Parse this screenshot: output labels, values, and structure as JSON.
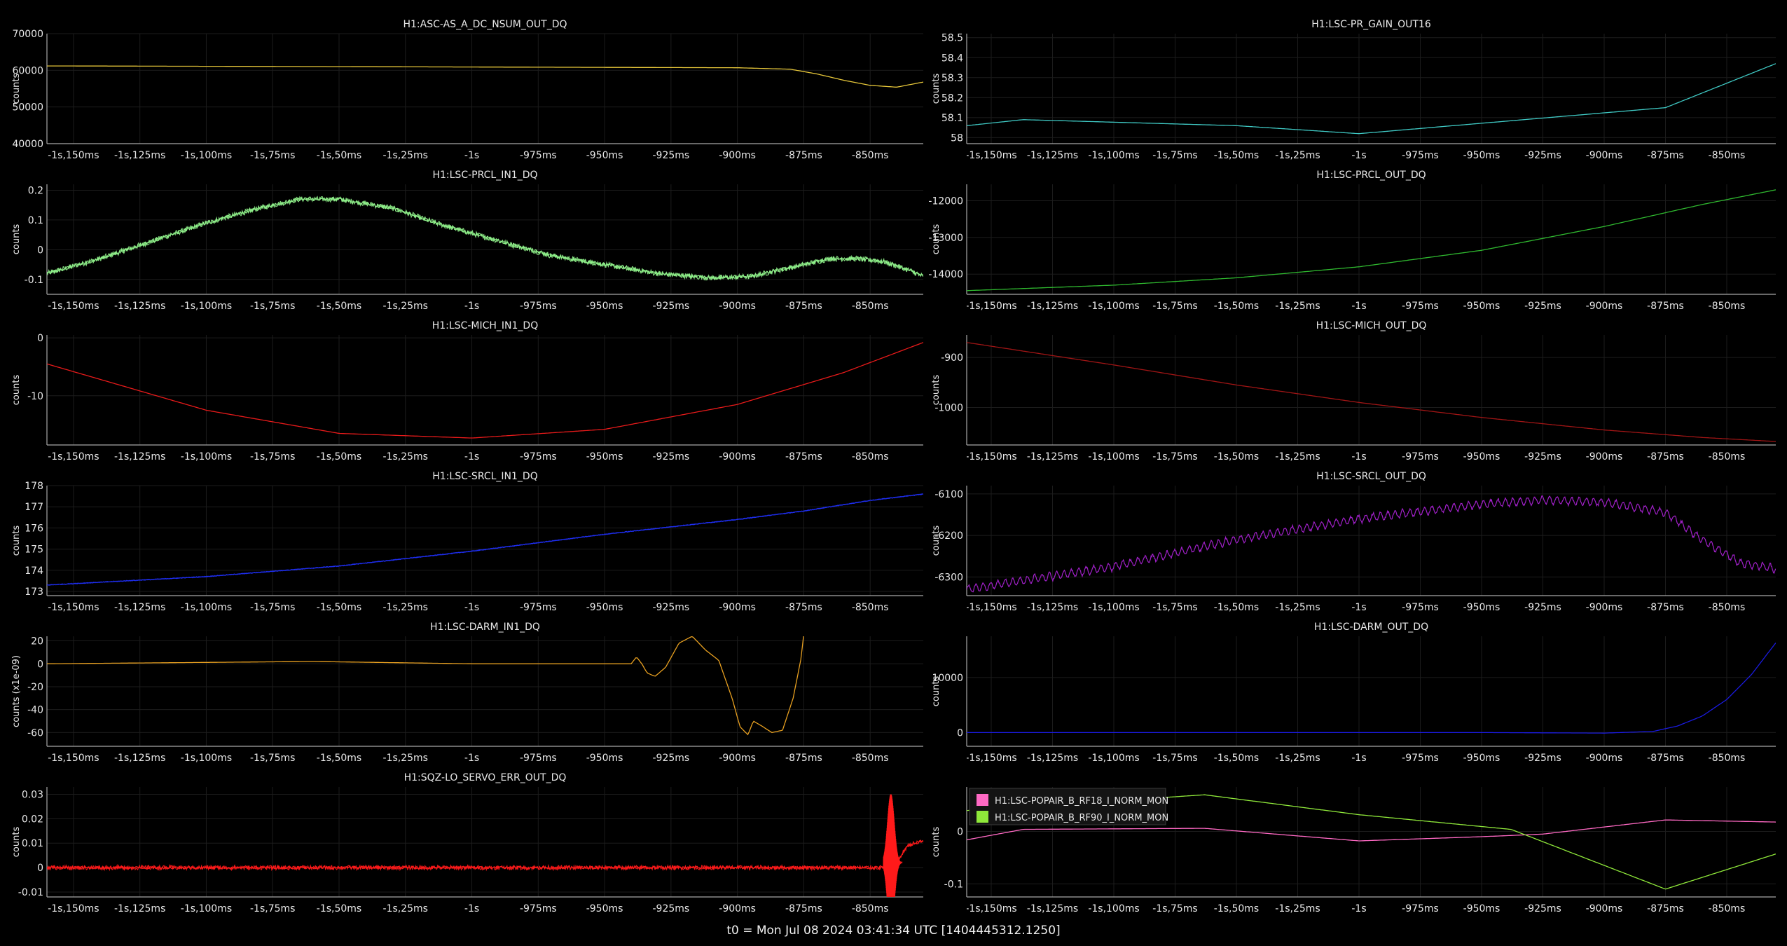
{
  "footer": "t0 = Mon Jul 08 2024 03:41:34 UTC [1404445312.1250]",
  "x_axis": {
    "xlim": [
      -1160,
      -830
    ],
    "ticks": [
      -1150,
      -1125,
      -1100,
      -1075,
      -1050,
      -1025,
      -1000,
      -975,
      -950,
      -925,
      -900,
      -875,
      -850
    ],
    "labels": [
      "-1s,150ms",
      "-1s,125ms",
      "-1s,100ms",
      "-1s,75ms",
      "-1s,50ms",
      "-1s,25ms",
      "-1s",
      "-975ms",
      "-950ms",
      "-925ms",
      "-900ms",
      "-875ms",
      "-850ms"
    ]
  },
  "chart_data": [
    {
      "type": "line",
      "title": "H1:ASC-AS_A_DC_NSUM_OUT_DQ",
      "ylabel": "counts",
      "ylim": [
        40000,
        70000
      ],
      "yticks": [
        40000,
        50000,
        60000,
        70000
      ],
      "ytick_labels": [
        "40000",
        "50000",
        "60000",
        "70000"
      ],
      "color": "#e8c83a",
      "noise": 0,
      "cycles": 0,
      "series": [
        {
          "x": [
            -1160,
            -1100,
            -1050,
            -1000,
            -950,
            -900,
            -880,
            -870,
            -860,
            -850,
            -840,
            -830
          ],
          "y": [
            61200,
            61100,
            61000,
            60900,
            60800,
            60700,
            60300,
            59000,
            57300,
            55900,
            55400,
            56800
          ]
        }
      ]
    },
    {
      "type": "line",
      "title": "H1:LSC-PR_GAIN_OUT16",
      "ylabel": "counts",
      "ylim": [
        57.97,
        58.52
      ],
      "yticks": [
        58,
        58.1,
        58.2,
        58.3,
        58.4,
        58.5
      ],
      "ytick_labels": [
        "58",
        "58.1",
        "58.2",
        "58.3",
        "58.4",
        "58.5"
      ],
      "color": "#3fc9c4",
      "noise": 0,
      "cycles": 0,
      "series": [
        {
          "x": [
            -1160,
            -1137,
            -1050,
            -1000,
            -875,
            -830
          ],
          "y": [
            58.06,
            58.09,
            58.06,
            58.02,
            58.15,
            58.37
          ]
        }
      ]
    },
    {
      "type": "line",
      "title": "H1:LSC-PRCL_IN1_DQ",
      "ylabel": "counts",
      "ylim": [
        -0.15,
        0.22
      ],
      "yticks": [
        -0.1,
        0,
        0.1,
        0.2
      ],
      "ytick_labels": [
        "-0.1",
        "0",
        "0.1",
        "0.2"
      ],
      "color": "#8ff08a",
      "noise": 0.009,
      "cycles": 0,
      "band": 0.015,
      "series": [
        {
          "x": [
            -1160,
            -1140,
            -1120,
            -1100,
            -1080,
            -1065,
            -1050,
            -1030,
            -1010,
            -990,
            -970,
            -950,
            -930,
            -910,
            -895,
            -880,
            -865,
            -855,
            -845,
            -835,
            -830
          ],
          "y": [
            -0.08,
            -0.03,
            0.03,
            0.09,
            0.14,
            0.17,
            0.17,
            0.14,
            0.08,
            0.03,
            -0.02,
            -0.05,
            -0.08,
            -0.095,
            -0.09,
            -0.06,
            -0.03,
            -0.03,
            -0.04,
            -0.07,
            -0.09
          ]
        }
      ]
    },
    {
      "type": "line",
      "title": "H1:LSC-PRCL_OUT_DQ",
      "ylabel": "counts",
      "ylim": [
        -14550,
        -11550
      ],
      "yticks": [
        -14000,
        -13000,
        -12000
      ],
      "ytick_labels": [
        "-14000",
        "-13000",
        "-12000"
      ],
      "color": "#2fb82f",
      "noise": 0,
      "cycles": 0,
      "series": [
        {
          "x": [
            -1160,
            -1100,
            -1050,
            -1000,
            -950,
            -900,
            -860,
            -830
          ],
          "y": [
            -14450,
            -14300,
            -14100,
            -13800,
            -13350,
            -12700,
            -12100,
            -11700
          ]
        }
      ]
    },
    {
      "type": "line",
      "title": "H1:LSC-MICH_IN1_DQ",
      "ylabel": "counts",
      "ylim": [
        -18.5,
        0.5
      ],
      "yticks": [
        -10,
        0
      ],
      "ytick_labels": [
        "-10",
        "0"
      ],
      "color": "#e81a1a",
      "noise": 0,
      "cycles": 0,
      "series": [
        {
          "x": [
            -1160,
            -1100,
            -1050,
            -1000,
            -950,
            -900,
            -860,
            -830
          ],
          "y": [
            -4.5,
            -12.5,
            -16.5,
            -17.3,
            -15.8,
            -11.5,
            -6,
            -0.8
          ]
        }
      ]
    },
    {
      "type": "line",
      "title": "H1:LSC-MICH_OUT_DQ",
      "ylabel": "counts",
      "ylim": [
        -1075,
        -855
      ],
      "yticks": [
        -1000,
        -900
      ],
      "ytick_labels": [
        "-1000",
        "-900"
      ],
      "color": "#a01515",
      "noise": 0,
      "cycles": 0,
      "series": [
        {
          "x": [
            -1160,
            -1100,
            -1050,
            -1000,
            -950,
            -900,
            -860,
            -830
          ],
          "y": [
            -870,
            -915,
            -955,
            -990,
            -1020,
            -1045,
            -1060,
            -1068
          ]
        }
      ]
    },
    {
      "type": "line",
      "title": "H1:LSC-SRCL_IN1_DQ",
      "ylabel": "counts",
      "ylim": [
        172.8,
        178.0
      ],
      "yticks": [
        173,
        174,
        175,
        176,
        177,
        178
      ],
      "ytick_labels": [
        "173",
        "174",
        "175",
        "176",
        "177",
        "178"
      ],
      "color": "#1e2ef0",
      "noise": 0.02,
      "cycles": 0,
      "band": 0.03,
      "series": [
        {
          "x": [
            -1160,
            -1100,
            -1050,
            -1000,
            -950,
            -900,
            -875,
            -850,
            -830
          ],
          "y": [
            173.3,
            173.7,
            174.2,
            174.9,
            175.7,
            176.4,
            176.8,
            177.3,
            177.6
          ]
        }
      ]
    },
    {
      "type": "line",
      "title": "H1:LSC-SRCL_OUT_DQ",
      "ylabel": "counts",
      "ylim": [
        -6345,
        -6080
      ],
      "yticks": [
        -6300,
        -6200,
        -6100
      ],
      "ytick_labels": [
        "-6300",
        "-6200",
        "-6100"
      ],
      "color": "#a020c8",
      "noise": 3,
      "cycles": 110,
      "cycamp": 11,
      "series": [
        {
          "x": [
            -1160,
            -1100,
            -1050,
            -1000,
            -950,
            -925,
            -900,
            -875,
            -860,
            -845,
            -830
          ],
          "y": [
            -6330,
            -6275,
            -6210,
            -6160,
            -6125,
            -6115,
            -6120,
            -6145,
            -6210,
            -6265,
            -6280
          ]
        }
      ]
    },
    {
      "type": "line",
      "title": "H1:LSC-DARM_IN1_DQ",
      "ylabel": "counts (x1e-09)",
      "ylim": [
        -72,
        24
      ],
      "yticks": [
        -60,
        -40,
        -20,
        0,
        20
      ],
      "ytick_labels": [
        "-60",
        "-40",
        "-20",
        "0",
        "20"
      ],
      "color": "#e8a020",
      "noise": 0,
      "cycles": 0,
      "series": [
        {
          "x": [
            -1160,
            -1060,
            -1000,
            -945,
            -940,
            -938,
            -936,
            -934,
            -931,
            -927,
            -922,
            -917,
            -912,
            -907,
            -902,
            -899,
            -896,
            -894,
            -891,
            -887,
            -883,
            -879,
            -876,
            -875
          ],
          "y": [
            0,
            2,
            0,
            0,
            0,
            6,
            0,
            -8,
            -11,
            -3,
            18,
            24,
            12,
            3,
            -30,
            -55,
            -62,
            -50,
            -54,
            -60,
            -58,
            -30,
            5,
            26
          ]
        }
      ]
    },
    {
      "type": "line",
      "title": "H1:LSC-DARM_OUT_DQ",
      "ylabel": "counts",
      "ylim": [
        -2500,
        17500
      ],
      "yticks": [
        0,
        10000
      ],
      "ytick_labels": [
        "0",
        "10000"
      ],
      "color": "#1a1ae0",
      "noise": 0,
      "cycles": 0,
      "series": [
        {
          "x": [
            -1160,
            -950,
            -900,
            -880,
            -870,
            -860,
            -850,
            -840,
            -830
          ],
          "y": [
            0,
            0,
            -100,
            200,
            1200,
            3000,
            6000,
            10500,
            16300
          ]
        }
      ]
    },
    {
      "type": "line",
      "title": "H1:SQZ-LO_SERVO_ERR_OUT_DQ",
      "ylabel": "counts",
      "ylim": [
        -0.012,
        0.033
      ],
      "yticks": [
        -0.01,
        0,
        0.01,
        0.02,
        0.03
      ],
      "ytick_labels": [
        "-0.01",
        "0",
        "0.01",
        "0.02",
        "0.03"
      ],
      "color": "#ff1a1a",
      "noise": 0.0009,
      "cycles": 0,
      "band": 0.0004,
      "series": [
        {
          "x": [
            -1160,
            -845,
            -840,
            -836,
            -830
          ],
          "y": [
            0,
            0,
            0.002,
            0.009,
            0.011
          ]
        }
      ]
    },
    {
      "type": "line",
      "title": "",
      "ylabel": "counts",
      "ylim": [
        -0.125,
        0.085
      ],
      "yticks": [
        -0.1,
        0
      ],
      "ytick_labels": [
        "-0.1",
        "0"
      ],
      "noise": 0,
      "cycles": 0,
      "legend": "top-left",
      "series": [
        {
          "name": "H1:LSC-POPAIR_B_RF18_I_NORM_MON",
          "color": "#ff69c4",
          "x": [
            -1160,
            -1137,
            -1063,
            -1000,
            -950,
            -925,
            -875,
            -830
          ],
          "y": [
            -0.016,
            0.004,
            0.006,
            -0.018,
            -0.01,
            -0.005,
            0.022,
            0.018
          ]
        },
        {
          "name": "H1:LSC-POPAIR_B_RF90_I_NORM_MON",
          "color": "#8fe83a",
          "x": [
            -1160,
            -1063,
            -1000,
            -938,
            -875,
            -830
          ],
          "y": [
            0.04,
            0.07,
            0.032,
            0.004,
            -0.11,
            -0.043
          ]
        }
      ]
    }
  ]
}
